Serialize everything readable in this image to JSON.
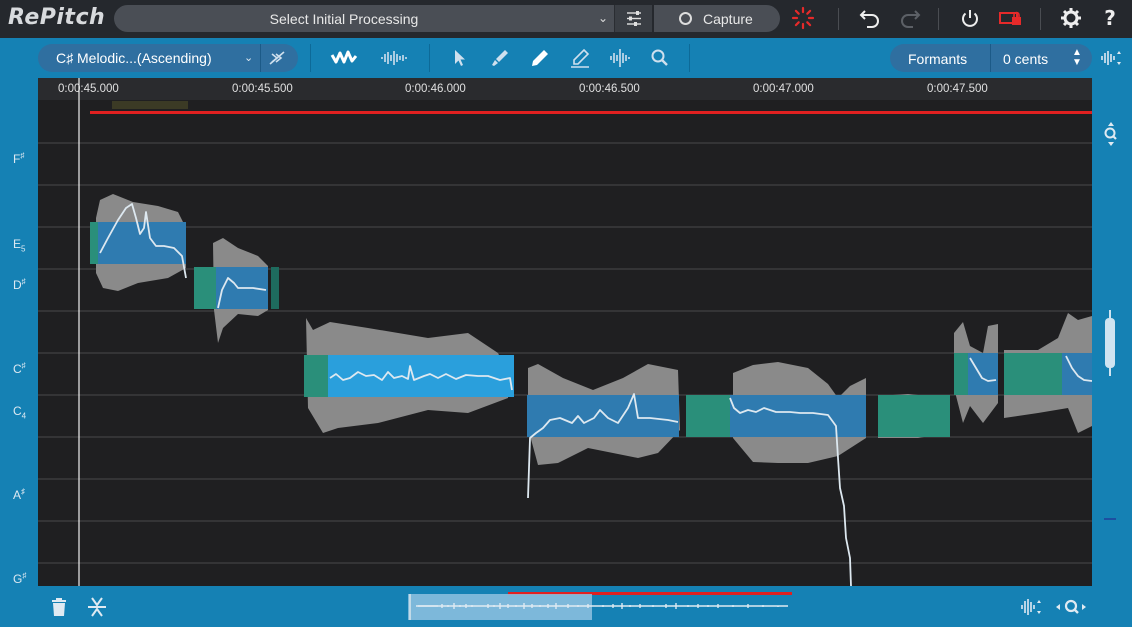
{
  "app": {
    "title": "RePitch"
  },
  "topbar": {
    "processing_label": "Select Initial Processing",
    "capture_label": "Capture"
  },
  "toolbar": {
    "scale_label": "C♯ Melodic...(Ascending)",
    "formants_label": "Formants",
    "cents_value": "0 cents"
  },
  "ruler": {
    "ticks": [
      "0:00:45.000",
      "0:00:45.500",
      "0:00:46.000",
      "0:00:46.500",
      "0:00:47.000",
      "0:00:47.500"
    ]
  },
  "pitch_labels": [
    {
      "note": "F",
      "mod": "♯"
    },
    {
      "note": "E",
      "mod": "5"
    },
    {
      "note": "D",
      "mod": "♯"
    },
    {
      "note": "C",
      "mod": "♯"
    },
    {
      "note": "C",
      "mod": "4"
    },
    {
      "note": "A",
      "mod": "♯"
    },
    {
      "note": "G",
      "mod": "♯"
    }
  ],
  "colors": {
    "accent": "#1581b4",
    "blob_selected": "#2a9fdc",
    "blob_unselected": "#2f7bb0",
    "blob_teal": "#2a8f7a",
    "waveform": "#8a8a8a",
    "playhead_range": "#e02020",
    "recording": "#e62a2a"
  },
  "icons": {
    "top": [
      "settings-sliders-icon",
      "capture-record-icon",
      "processing-spinner-icon",
      "undo-icon",
      "redo-icon",
      "power-icon",
      "battery-lock-icon",
      "gear-icon",
      "help-icon"
    ],
    "tools": [
      "bypass-icon",
      "pitch-curve-view-icon",
      "waveform-view-icon",
      "pointer-tool-icon",
      "pitch-brush-tool-icon",
      "pencil-tool-icon",
      "line-tool-icon",
      "split-tool-icon",
      "zoom-tool-icon"
    ]
  }
}
